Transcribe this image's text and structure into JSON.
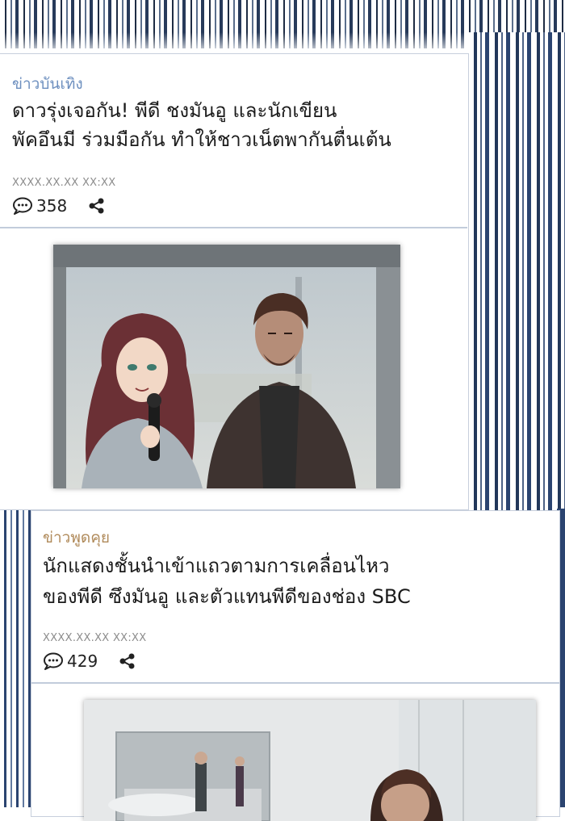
{
  "articles": [
    {
      "category": "ข่าวบันเทิง",
      "headline_line1": "ดาวรุ่งเจอกัน! พีดี ชงมันอู และนักเขียน",
      "headline_line2": "พัคอึนมี ร่วมมือกัน ทำให้ชาวเน็ตพากันตื่นเต้น",
      "timestamp": "XXXX.XX.XX  XX:XX",
      "comment_count": "358"
    },
    {
      "category": "ข่าวพูดคุย",
      "headline_line1": "นักแสดงชั้นนำเข้าแถวตามการเคลื่อนไหว",
      "headline_line2": "ของพีดี ซึงมันอู และตัวแทนพีดีของช่อง SBC",
      "timestamp": "XXXX.XX.XX  XX:XX",
      "comment_count": "429"
    }
  ],
  "icons": {
    "comment": "comment-bubble-icon",
    "share": "share-icon"
  },
  "colors": {
    "stripe_dark": "#1e2c44",
    "stripe_blue": "#2b4470",
    "category1": "#6d8fbf",
    "category2": "#b08a5a"
  }
}
